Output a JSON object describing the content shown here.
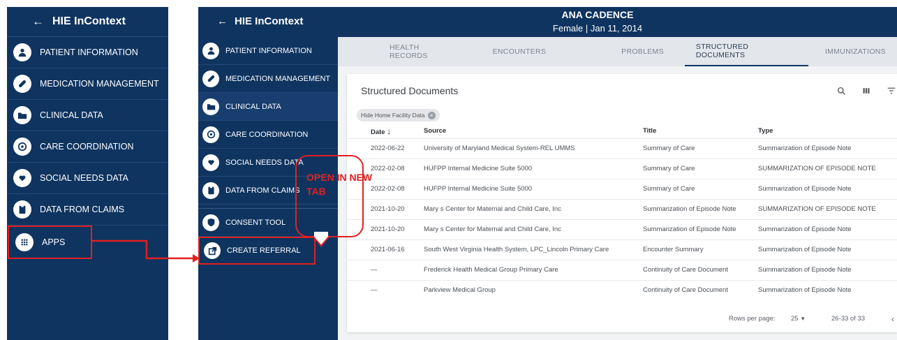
{
  "left_panel": {
    "title": "HIE InContext",
    "items": [
      {
        "label": "PATIENT INFORMATION",
        "icon": "user-icon"
      },
      {
        "label": "MEDICATION MANAGEMENT",
        "icon": "pill-icon"
      },
      {
        "label": "CLINICAL DATA",
        "icon": "folder-icon"
      },
      {
        "label": "CARE COORDINATION",
        "icon": "care-icon"
      },
      {
        "label": "SOCIAL NEEDS DATA",
        "icon": "hands-heart-icon"
      },
      {
        "label": "DATA FROM CLAIMS",
        "icon": "clipboard-icon"
      },
      {
        "label": "APPS",
        "icon": "grid-icon"
      }
    ]
  },
  "right_window": {
    "title": "HIE InContext",
    "patient": {
      "name": "ANA CADENCE",
      "details": "Female | Jan 11, 2014"
    },
    "sidebar": [
      {
        "label": "PATIENT INFORMATION"
      },
      {
        "label": "MEDICATION MANAGEMENT"
      },
      {
        "label": "CLINICAL DATA"
      },
      {
        "label": "CARE COORDINATION"
      },
      {
        "label": "SOCIAL NEEDS DATA"
      },
      {
        "label": "DATA FROM CLAIMS"
      },
      {
        "label": "CONSENT TOOL"
      },
      {
        "label": "CREATE REFERRAL"
      }
    ],
    "tabs": [
      "HEALTH RECORDS",
      "ENCOUNTERS",
      "PROBLEMS",
      "STRUCTURED DOCUMENTS",
      "IMMUNIZATIONS"
    ],
    "active_tab": "STRUCTURED DOCUMENTS",
    "card": {
      "title": "Structured Documents",
      "chip": "Hide Home Facility Data",
      "columns": [
        "Date",
        "Source",
        "Title",
        "Type"
      ],
      "rows": [
        [
          "2022-06-22",
          "University of Maryland Medical System-REL UMMS",
          "Summary of Care",
          "Summarization of Episode Note"
        ],
        [
          "2022-02-08",
          "HUFPP Internal Medicine Suite 5000",
          "Summary of Care",
          "SUMMARIZATION OF EPISODE NOTE"
        ],
        [
          "2022-02-08",
          "HUFPP Internal Medicine Suite 5000",
          "Summary of Care",
          "Summarization of Episode Note"
        ],
        [
          "2021-10-20",
          "Mary s Center for Maternal and Child Care, Inc",
          "Summarization of Episode Note",
          "SUMMARIZATION OF EPISODE NOTE"
        ],
        [
          "2021-10-20",
          "Mary s Center for Maternal and Child Care, Inc",
          "Summarization of Episode Note",
          "Summarization of Episode Note"
        ],
        [
          "2021-06-16",
          "South West Virginia Health System, LPC_Lincoln Primary Care",
          "Encounter Summary",
          "Summarization of Episode Note"
        ],
        [
          "—",
          "Frederick Health Medical Group Primary Care",
          "Continuity of Care Document",
          "Summarization of Episode Note"
        ],
        [
          "—",
          "Parkview Medical Group",
          "Continuity of Care Document",
          "Summarization of Episode Note"
        ]
      ],
      "footer": {
        "rows_per_page_label": "Rows per page:",
        "rows_per_page_value": "25",
        "range": "26-33 of 33"
      }
    }
  },
  "callout": {
    "line1": "OPEN IN NEW",
    "line2": "TAB"
  },
  "colors": {
    "navy": "#0f3460",
    "highlight_red": "#e02020"
  }
}
